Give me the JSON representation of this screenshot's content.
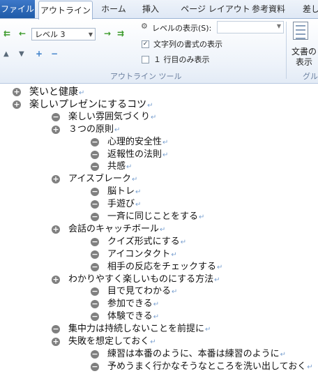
{
  "tabs": {
    "file": "ファイル",
    "outline": "アウトライン",
    "home": "ホーム",
    "insert": "挿入",
    "page_layout": "ページ レイアウト",
    "references": "参考資料",
    "mailings_cut": "差し"
  },
  "ribbon": {
    "level_value": "レベル 3",
    "show_level_label": "レベルの表示(S):",
    "show_level_value": "",
    "show_text_formatting_label": "文字列の書式の表示",
    "show_text_formatting_checked": true,
    "first_line_only_label": "１ 行目のみ表示",
    "first_line_only_checked": false,
    "show_document_label_1": "文書の",
    "show_document_label_2": "表示",
    "group_outline_tools": "アウトライン ツール",
    "group_master_cut": "グル"
  },
  "outline": [
    {
      "level": 1,
      "symbol": "+",
      "text": "笑いと健康"
    },
    {
      "level": 1,
      "symbol": "+",
      "text": "楽しいプレゼンにするコツ"
    },
    {
      "level": 2,
      "symbol": "−",
      "text": "楽しい雰囲気づくり"
    },
    {
      "level": 2,
      "symbol": "+",
      "text": "３つの原則"
    },
    {
      "level": 3,
      "symbol": "−",
      "text": "心理的安全性"
    },
    {
      "level": 3,
      "symbol": "−",
      "text": "返報性の法則"
    },
    {
      "level": 3,
      "symbol": "−",
      "text": "共感"
    },
    {
      "level": 2,
      "symbol": "+",
      "text": "アイスブレーク"
    },
    {
      "level": 3,
      "symbol": "−",
      "text": "脳トレ"
    },
    {
      "level": 3,
      "symbol": "−",
      "text": "手遊び"
    },
    {
      "level": 3,
      "symbol": "−",
      "text": "一斉に同じことをする"
    },
    {
      "level": 2,
      "symbol": "+",
      "text": "会話のキャッチボール"
    },
    {
      "level": 3,
      "symbol": "−",
      "text": "クイズ形式にする"
    },
    {
      "level": 3,
      "symbol": "−",
      "text": "アイコンタクト"
    },
    {
      "level": 3,
      "symbol": "−",
      "text": "相手の反応をチェックする"
    },
    {
      "level": 2,
      "symbol": "+",
      "text": "わかりやすく楽しいものにする方法"
    },
    {
      "level": 3,
      "symbol": "−",
      "text": "目で見てわかる"
    },
    {
      "level": 3,
      "symbol": "−",
      "text": "参加できる"
    },
    {
      "level": 3,
      "symbol": "−",
      "text": "体験できる"
    },
    {
      "level": 2,
      "symbol": "−",
      "text": "集中力は持続しないことを前提に"
    },
    {
      "level": 2,
      "symbol": "+",
      "text": "失敗を想定しておく"
    },
    {
      "level": 3,
      "symbol": "−",
      "text": "練習は本番のように、本番は練習のように"
    },
    {
      "level": 3,
      "symbol": "−",
      "text": "予めうまく行かなそうなところを洗い出しておく"
    }
  ],
  "paragraph_mark": "↵"
}
